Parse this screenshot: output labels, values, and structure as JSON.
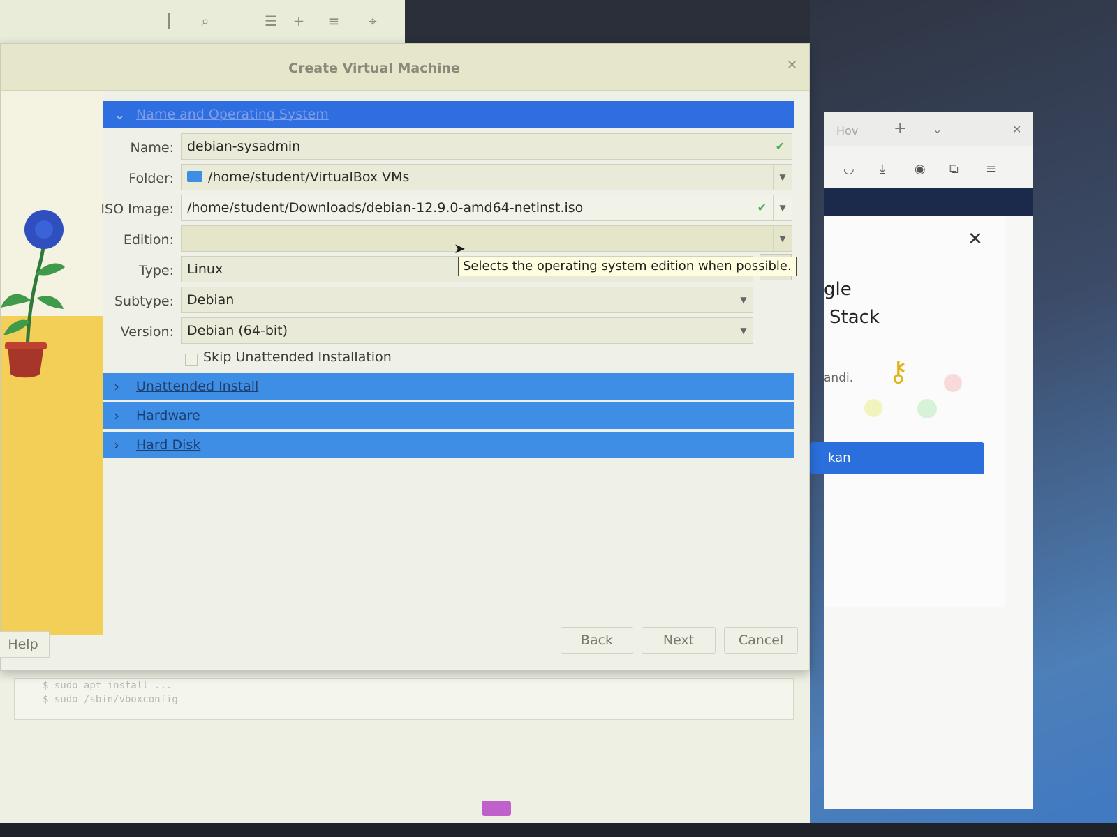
{
  "dialog": {
    "title": "Create Virtual Machine",
    "sections": {
      "name_os": "Name and Operating System",
      "unattended": "Unattended Install",
      "hardware": "Hardware",
      "hard_disk": "Hard Disk"
    },
    "fields": {
      "name_label": "Name:",
      "name_value": "debian-sysadmin",
      "folder_label": "Folder:",
      "folder_value": "/home/student/VirtualBox VMs",
      "iso_label": "ISO Image:",
      "iso_value": "/home/student/Downloads/debian-12.9.0-amd64-netinst.iso",
      "edition_label": "Edition:",
      "edition_value": "",
      "type_label": "Type:",
      "type_value": "Linux",
      "subtype_label": "Subtype:",
      "subtype_value": "Debian",
      "version_label": "Version:",
      "version_value": "Debian (64-bit)"
    },
    "skip_unattended_label": "Skip Unattended Installation",
    "skip_unattended_checked": false,
    "tooltip": "Selects the operating system edition when possible.",
    "buttons": {
      "help": "Help",
      "back": "Back",
      "next": "Next",
      "cancel": "Cancel"
    }
  },
  "background": {
    "log_line_1": "$ sudo apt install ... ",
    "log_line_2": "$ sudo /sbin/vboxconfig",
    "browser": {
      "tab_label": "Hov",
      "popup_text_1": "gle",
      "popup_text_2": "Stack",
      "popup_text_3": "andi.",
      "popup_button": "kan"
    }
  },
  "colors": {
    "section_header": "#3e8ee6",
    "section_header_top": "#2f6ee0",
    "dialog_bg": "#eff0e7",
    "tooltip_bg": "#fffde0",
    "deco_yellow": "#f3cf58"
  },
  "icons": {
    "valid_check": "check-icon",
    "folder": "folder-icon",
    "dropdown": "chevron-down-icon",
    "section_expand": "chevron-right-icon",
    "section_collapse": "chevron-down-icon",
    "close": "close-icon",
    "key": "key-icon"
  }
}
